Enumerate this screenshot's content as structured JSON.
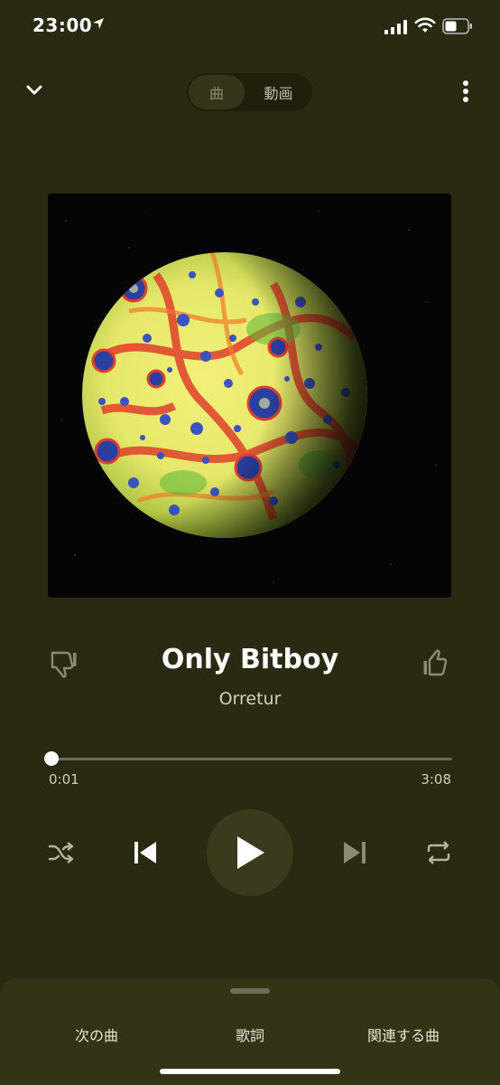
{
  "status_bar": {
    "time": "23:00"
  },
  "header": {
    "segments": [
      {
        "label": "曲"
      },
      {
        "label": "動画"
      }
    ],
    "selected_segment": "曲"
  },
  "track": {
    "title": "Only Bitboy",
    "artist": "Orretur"
  },
  "playback": {
    "elapsed": "0:01",
    "duration": "3:08",
    "progress_fraction": 0.005
  },
  "bottom_sheet": {
    "tabs": [
      {
        "label": "次の曲"
      },
      {
        "label": "歌詞"
      },
      {
        "label": "関連する曲"
      }
    ]
  },
  "icons": {
    "collapse": "chevron-down-icon",
    "more": "more-vert-icon",
    "dislike": "thumbs-down-icon",
    "like": "thumbs-up-icon",
    "shuffle": "shuffle-icon",
    "previous": "skip-previous-icon",
    "play": "play-icon",
    "next": "skip-next-icon",
    "repeat": "repeat-icon"
  },
  "colors": {
    "background": "#2a2a12",
    "sheet": "#333316",
    "play_circle": "#3a3a1c"
  }
}
